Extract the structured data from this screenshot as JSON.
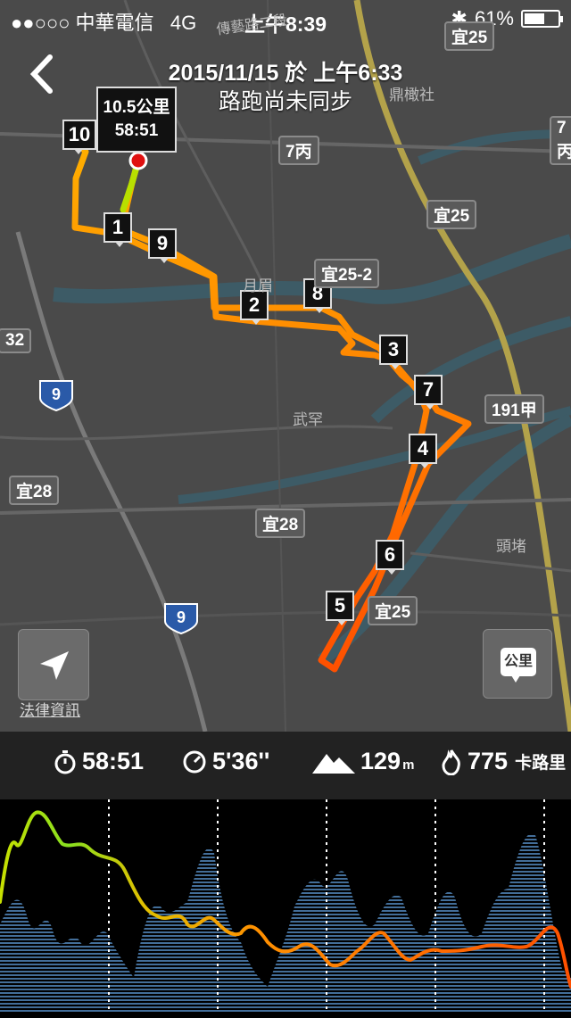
{
  "status_bar": {
    "carrier": "●●○○○ 中華電信",
    "network": "4G",
    "time": "上午8:39",
    "battery": "61%",
    "battery_level": 0.61
  },
  "header": {
    "title": "2015/11/15 於 上午6:33",
    "subtitle": "路跑尚未同步"
  },
  "summary_callout": {
    "distance": "10.5公里",
    "duration": "58:51"
  },
  "km_markers": [
    "1",
    "2",
    "3",
    "4",
    "5",
    "6",
    "7",
    "8",
    "9",
    "10"
  ],
  "map_labels": {
    "road_labels": [
      "宜25",
      "7丙",
      "宜25",
      "宜25-2",
      "191甲",
      "宜28",
      "宜28",
      "宜25",
      "32",
      "7丙"
    ],
    "highway_shields": [
      "9",
      "9"
    ],
    "place_names": [
      "鼎橄社",
      "武罕",
      "頭堵",
      "月眉",
      "傳藝路二段"
    ]
  },
  "controls": {
    "legal_label": "法律資訊",
    "unit_label": "公里"
  },
  "stats": {
    "duration": "58:51",
    "pace": "5'36''",
    "elevation": "129",
    "elevation_unit": "m",
    "calories": "775",
    "calories_unit": "卡路里"
  },
  "colors": {
    "map_bg": "#4a4a4a",
    "route_start": "#b8e000",
    "route_mid": "#ffa000",
    "route_end": "#ff5a00",
    "water": "#3a5560",
    "elevation_fill": "#2a4a6a"
  }
}
